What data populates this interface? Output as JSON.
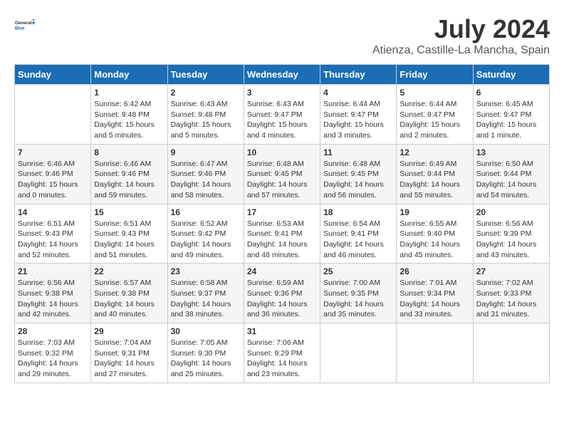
{
  "header": {
    "logo_general": "General",
    "logo_blue": "Blue",
    "title": "July 2024",
    "subtitle": "Atienza, Castille-La Mancha, Spain"
  },
  "weekdays": [
    "Sunday",
    "Monday",
    "Tuesday",
    "Wednesday",
    "Thursday",
    "Friday",
    "Saturday"
  ],
  "weeks": [
    [
      {
        "day": "",
        "sunrise": "",
        "sunset": "",
        "daylight": ""
      },
      {
        "day": "1",
        "sunrise": "Sunrise: 6:42 AM",
        "sunset": "Sunset: 9:48 PM",
        "daylight": "Daylight: 15 hours and 5 minutes."
      },
      {
        "day": "2",
        "sunrise": "Sunrise: 6:43 AM",
        "sunset": "Sunset: 9:48 PM",
        "daylight": "Daylight: 15 hours and 5 minutes."
      },
      {
        "day": "3",
        "sunrise": "Sunrise: 6:43 AM",
        "sunset": "Sunset: 9:47 PM",
        "daylight": "Daylight: 15 hours and 4 minutes."
      },
      {
        "day": "4",
        "sunrise": "Sunrise: 6:44 AM",
        "sunset": "Sunset: 9:47 PM",
        "daylight": "Daylight: 15 hours and 3 minutes."
      },
      {
        "day": "5",
        "sunrise": "Sunrise: 6:44 AM",
        "sunset": "Sunset: 9:47 PM",
        "daylight": "Daylight: 15 hours and 2 minutes."
      },
      {
        "day": "6",
        "sunrise": "Sunrise: 6:45 AM",
        "sunset": "Sunset: 9:47 PM",
        "daylight": "Daylight: 15 hours and 1 minute."
      }
    ],
    [
      {
        "day": "7",
        "sunrise": "Sunrise: 6:46 AM",
        "sunset": "Sunset: 9:46 PM",
        "daylight": "Daylight: 15 hours and 0 minutes."
      },
      {
        "day": "8",
        "sunrise": "Sunrise: 6:46 AM",
        "sunset": "Sunset: 9:46 PM",
        "daylight": "Daylight: 14 hours and 59 minutes."
      },
      {
        "day": "9",
        "sunrise": "Sunrise: 6:47 AM",
        "sunset": "Sunset: 9:46 PM",
        "daylight": "Daylight: 14 hours and 58 minutes."
      },
      {
        "day": "10",
        "sunrise": "Sunrise: 6:48 AM",
        "sunset": "Sunset: 9:45 PM",
        "daylight": "Daylight: 14 hours and 57 minutes."
      },
      {
        "day": "11",
        "sunrise": "Sunrise: 6:48 AM",
        "sunset": "Sunset: 9:45 PM",
        "daylight": "Daylight: 14 hours and 56 minutes."
      },
      {
        "day": "12",
        "sunrise": "Sunrise: 6:49 AM",
        "sunset": "Sunset: 9:44 PM",
        "daylight": "Daylight: 14 hours and 55 minutes."
      },
      {
        "day": "13",
        "sunrise": "Sunrise: 6:50 AM",
        "sunset": "Sunset: 9:44 PM",
        "daylight": "Daylight: 14 hours and 54 minutes."
      }
    ],
    [
      {
        "day": "14",
        "sunrise": "Sunrise: 6:51 AM",
        "sunset": "Sunset: 9:43 PM",
        "daylight": "Daylight: 14 hours and 52 minutes."
      },
      {
        "day": "15",
        "sunrise": "Sunrise: 6:51 AM",
        "sunset": "Sunset: 9:43 PM",
        "daylight": "Daylight: 14 hours and 51 minutes."
      },
      {
        "day": "16",
        "sunrise": "Sunrise: 6:52 AM",
        "sunset": "Sunset: 9:42 PM",
        "daylight": "Daylight: 14 hours and 49 minutes."
      },
      {
        "day": "17",
        "sunrise": "Sunrise: 6:53 AM",
        "sunset": "Sunset: 9:41 PM",
        "daylight": "Daylight: 14 hours and 48 minutes."
      },
      {
        "day": "18",
        "sunrise": "Sunrise: 6:54 AM",
        "sunset": "Sunset: 9:41 PM",
        "daylight": "Daylight: 14 hours and 46 minutes."
      },
      {
        "day": "19",
        "sunrise": "Sunrise: 6:55 AM",
        "sunset": "Sunset: 9:40 PM",
        "daylight": "Daylight: 14 hours and 45 minutes."
      },
      {
        "day": "20",
        "sunrise": "Sunrise: 6:56 AM",
        "sunset": "Sunset: 9:39 PM",
        "daylight": "Daylight: 14 hours and 43 minutes."
      }
    ],
    [
      {
        "day": "21",
        "sunrise": "Sunrise: 6:56 AM",
        "sunset": "Sunset: 9:38 PM",
        "daylight": "Daylight: 14 hours and 42 minutes."
      },
      {
        "day": "22",
        "sunrise": "Sunrise: 6:57 AM",
        "sunset": "Sunset: 9:38 PM",
        "daylight": "Daylight: 14 hours and 40 minutes."
      },
      {
        "day": "23",
        "sunrise": "Sunrise: 6:58 AM",
        "sunset": "Sunset: 9:37 PM",
        "daylight": "Daylight: 14 hours and 38 minutes."
      },
      {
        "day": "24",
        "sunrise": "Sunrise: 6:59 AM",
        "sunset": "Sunset: 9:36 PM",
        "daylight": "Daylight: 14 hours and 36 minutes."
      },
      {
        "day": "25",
        "sunrise": "Sunrise: 7:00 AM",
        "sunset": "Sunset: 9:35 PM",
        "daylight": "Daylight: 14 hours and 35 minutes."
      },
      {
        "day": "26",
        "sunrise": "Sunrise: 7:01 AM",
        "sunset": "Sunset: 9:34 PM",
        "daylight": "Daylight: 14 hours and 33 minutes."
      },
      {
        "day": "27",
        "sunrise": "Sunrise: 7:02 AM",
        "sunset": "Sunset: 9:33 PM",
        "daylight": "Daylight: 14 hours and 31 minutes."
      }
    ],
    [
      {
        "day": "28",
        "sunrise": "Sunrise: 7:03 AM",
        "sunset": "Sunset: 9:32 PM",
        "daylight": "Daylight: 14 hours and 29 minutes."
      },
      {
        "day": "29",
        "sunrise": "Sunrise: 7:04 AM",
        "sunset": "Sunset: 9:31 PM",
        "daylight": "Daylight: 14 hours and 27 minutes."
      },
      {
        "day": "30",
        "sunrise": "Sunrise: 7:05 AM",
        "sunset": "Sunset: 9:30 PM",
        "daylight": "Daylight: 14 hours and 25 minutes."
      },
      {
        "day": "31",
        "sunrise": "Sunrise: 7:06 AM",
        "sunset": "Sunset: 9:29 PM",
        "daylight": "Daylight: 14 hours and 23 minutes."
      },
      {
        "day": "",
        "sunrise": "",
        "sunset": "",
        "daylight": ""
      },
      {
        "day": "",
        "sunrise": "",
        "sunset": "",
        "daylight": ""
      },
      {
        "day": "",
        "sunrise": "",
        "sunset": "",
        "daylight": ""
      }
    ]
  ]
}
